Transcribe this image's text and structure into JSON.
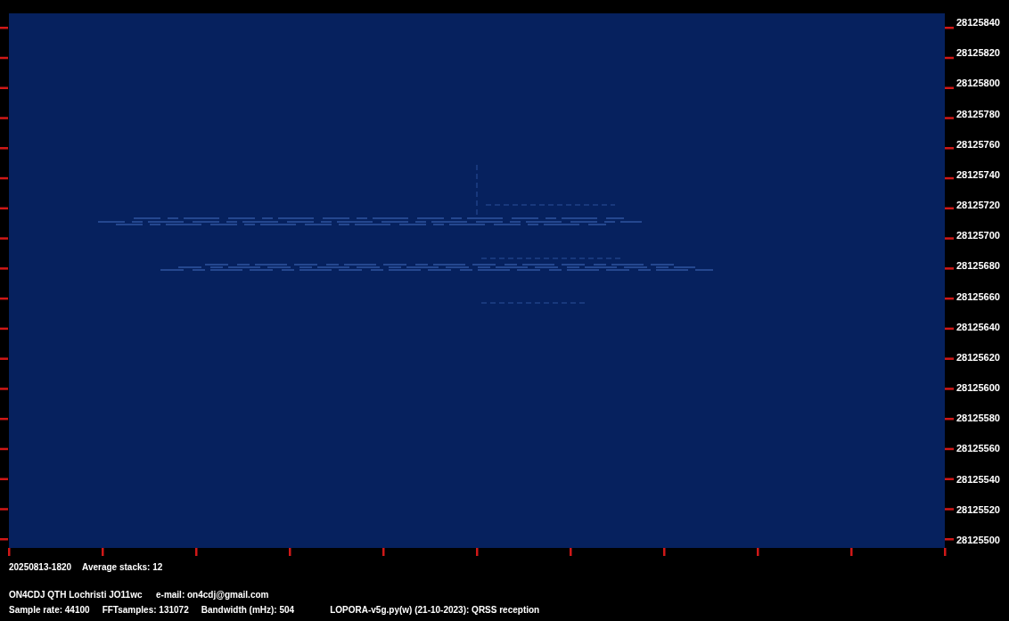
{
  "frequency_labels": [
    "28125840",
    "28125820",
    "28125800",
    "28125780",
    "28125760",
    "28125740",
    "28125720",
    "28125700",
    "28125680",
    "28125660",
    "28125640",
    "28125620",
    "28125600",
    "28125580",
    "28125560",
    "28125540",
    "28125520",
    "28125500"
  ],
  "status": {
    "timestamp": "20250813-1820",
    "average_stacks": "Average stacks: 12"
  },
  "station": {
    "callsign": "ON4CDJ QTH Lochristi JO11wc",
    "email": "e-mail: on4cdj@gmail.com"
  },
  "settings": [
    {
      "text": "Sample rate: 44100"
    },
    {
      "text": "FFTsamples: 131072"
    },
    {
      "text": "Bandwidth (mHz): 504"
    },
    {
      "text": "LOPORA-v5g.py(w) (21-10-2023): QRSS reception"
    }
  ]
}
